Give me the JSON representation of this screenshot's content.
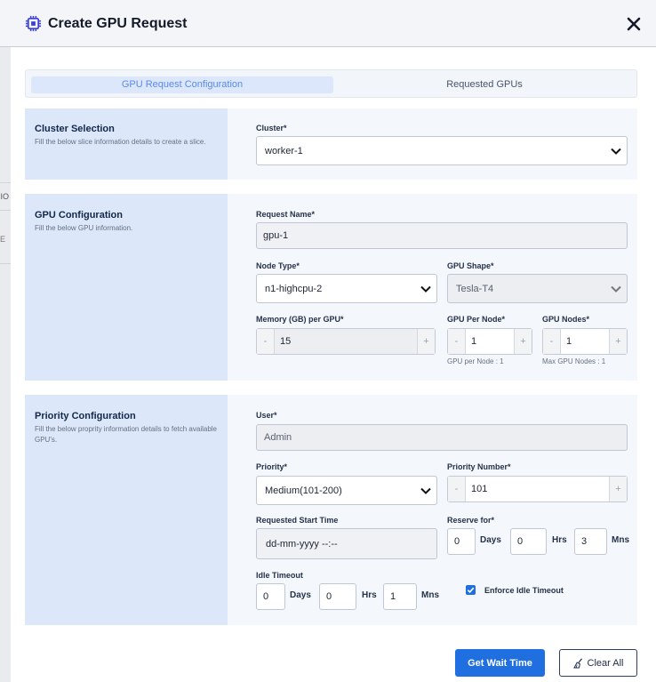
{
  "header": {
    "title": "Create GPU Request"
  },
  "backdrop": {
    "tab_fragment": "RIO",
    "mark": "E"
  },
  "tabs": [
    {
      "label": "GPU Request Configuration",
      "active": true
    },
    {
      "label": "Requested GPUs",
      "active": false
    }
  ],
  "cluster_section": {
    "title": "Cluster Selection",
    "desc": "Fill the below slice information details to create a slice.",
    "cluster_label": "Cluster*",
    "cluster_value": "worker-1"
  },
  "gpu_section": {
    "title": "GPU Configuration",
    "desc": "Fill the below GPU information.",
    "request_name_label": "Request Name*",
    "request_name_value": "gpu-1",
    "node_type_label": "Node Type*",
    "node_type_value": "n1-highcpu-2",
    "gpu_shape_label": "GPU Shape*",
    "gpu_shape_value": "Tesla-T4",
    "memory_label": "Memory (GB) per GPU*",
    "memory_value": "15",
    "gpu_per_node_label": "GPU Per Node*",
    "gpu_per_node_value": "1",
    "gpu_per_node_hint": "GPU per Node : 1",
    "gpu_nodes_label": "GPU Nodes*",
    "gpu_nodes_value": "1",
    "gpu_nodes_hint": "Max GPU Nodes : 1",
    "minus": "-",
    "plus": "+"
  },
  "priority_section": {
    "title": "Priority Configuration",
    "desc": "Fill the below proprity information details to fetch available GPU's.",
    "user_label": "User*",
    "user_value": "Admin",
    "priority_label": "Priority*",
    "priority_value": "Medium(101-200)",
    "priority_number_label": "Priority Number*",
    "priority_number_value": "101",
    "start_time_label": "Requested Start Time",
    "start_time_placeholder": "dd-mm-yyyy --:--",
    "reserve_label": "Reserve for*",
    "reserve_days": "0",
    "reserve_hrs": "0",
    "reserve_mns": "3",
    "idle_label": "Idle Timeout",
    "idle_days": "0",
    "idle_hrs": "0",
    "idle_mns": "1",
    "unit_days": "Days",
    "unit_hrs": "Hrs",
    "unit_mns": "Mns",
    "enforce_label": "Enforce Idle Timeout",
    "enforce_checked": true
  },
  "actions": {
    "wait_time_label": "Get Wait Time",
    "clear_label": "Clear All"
  },
  "colors": {
    "primary": "#1f6fe0",
    "side_panel": "#dde7fa",
    "section_bg": "#f4f7fc"
  }
}
